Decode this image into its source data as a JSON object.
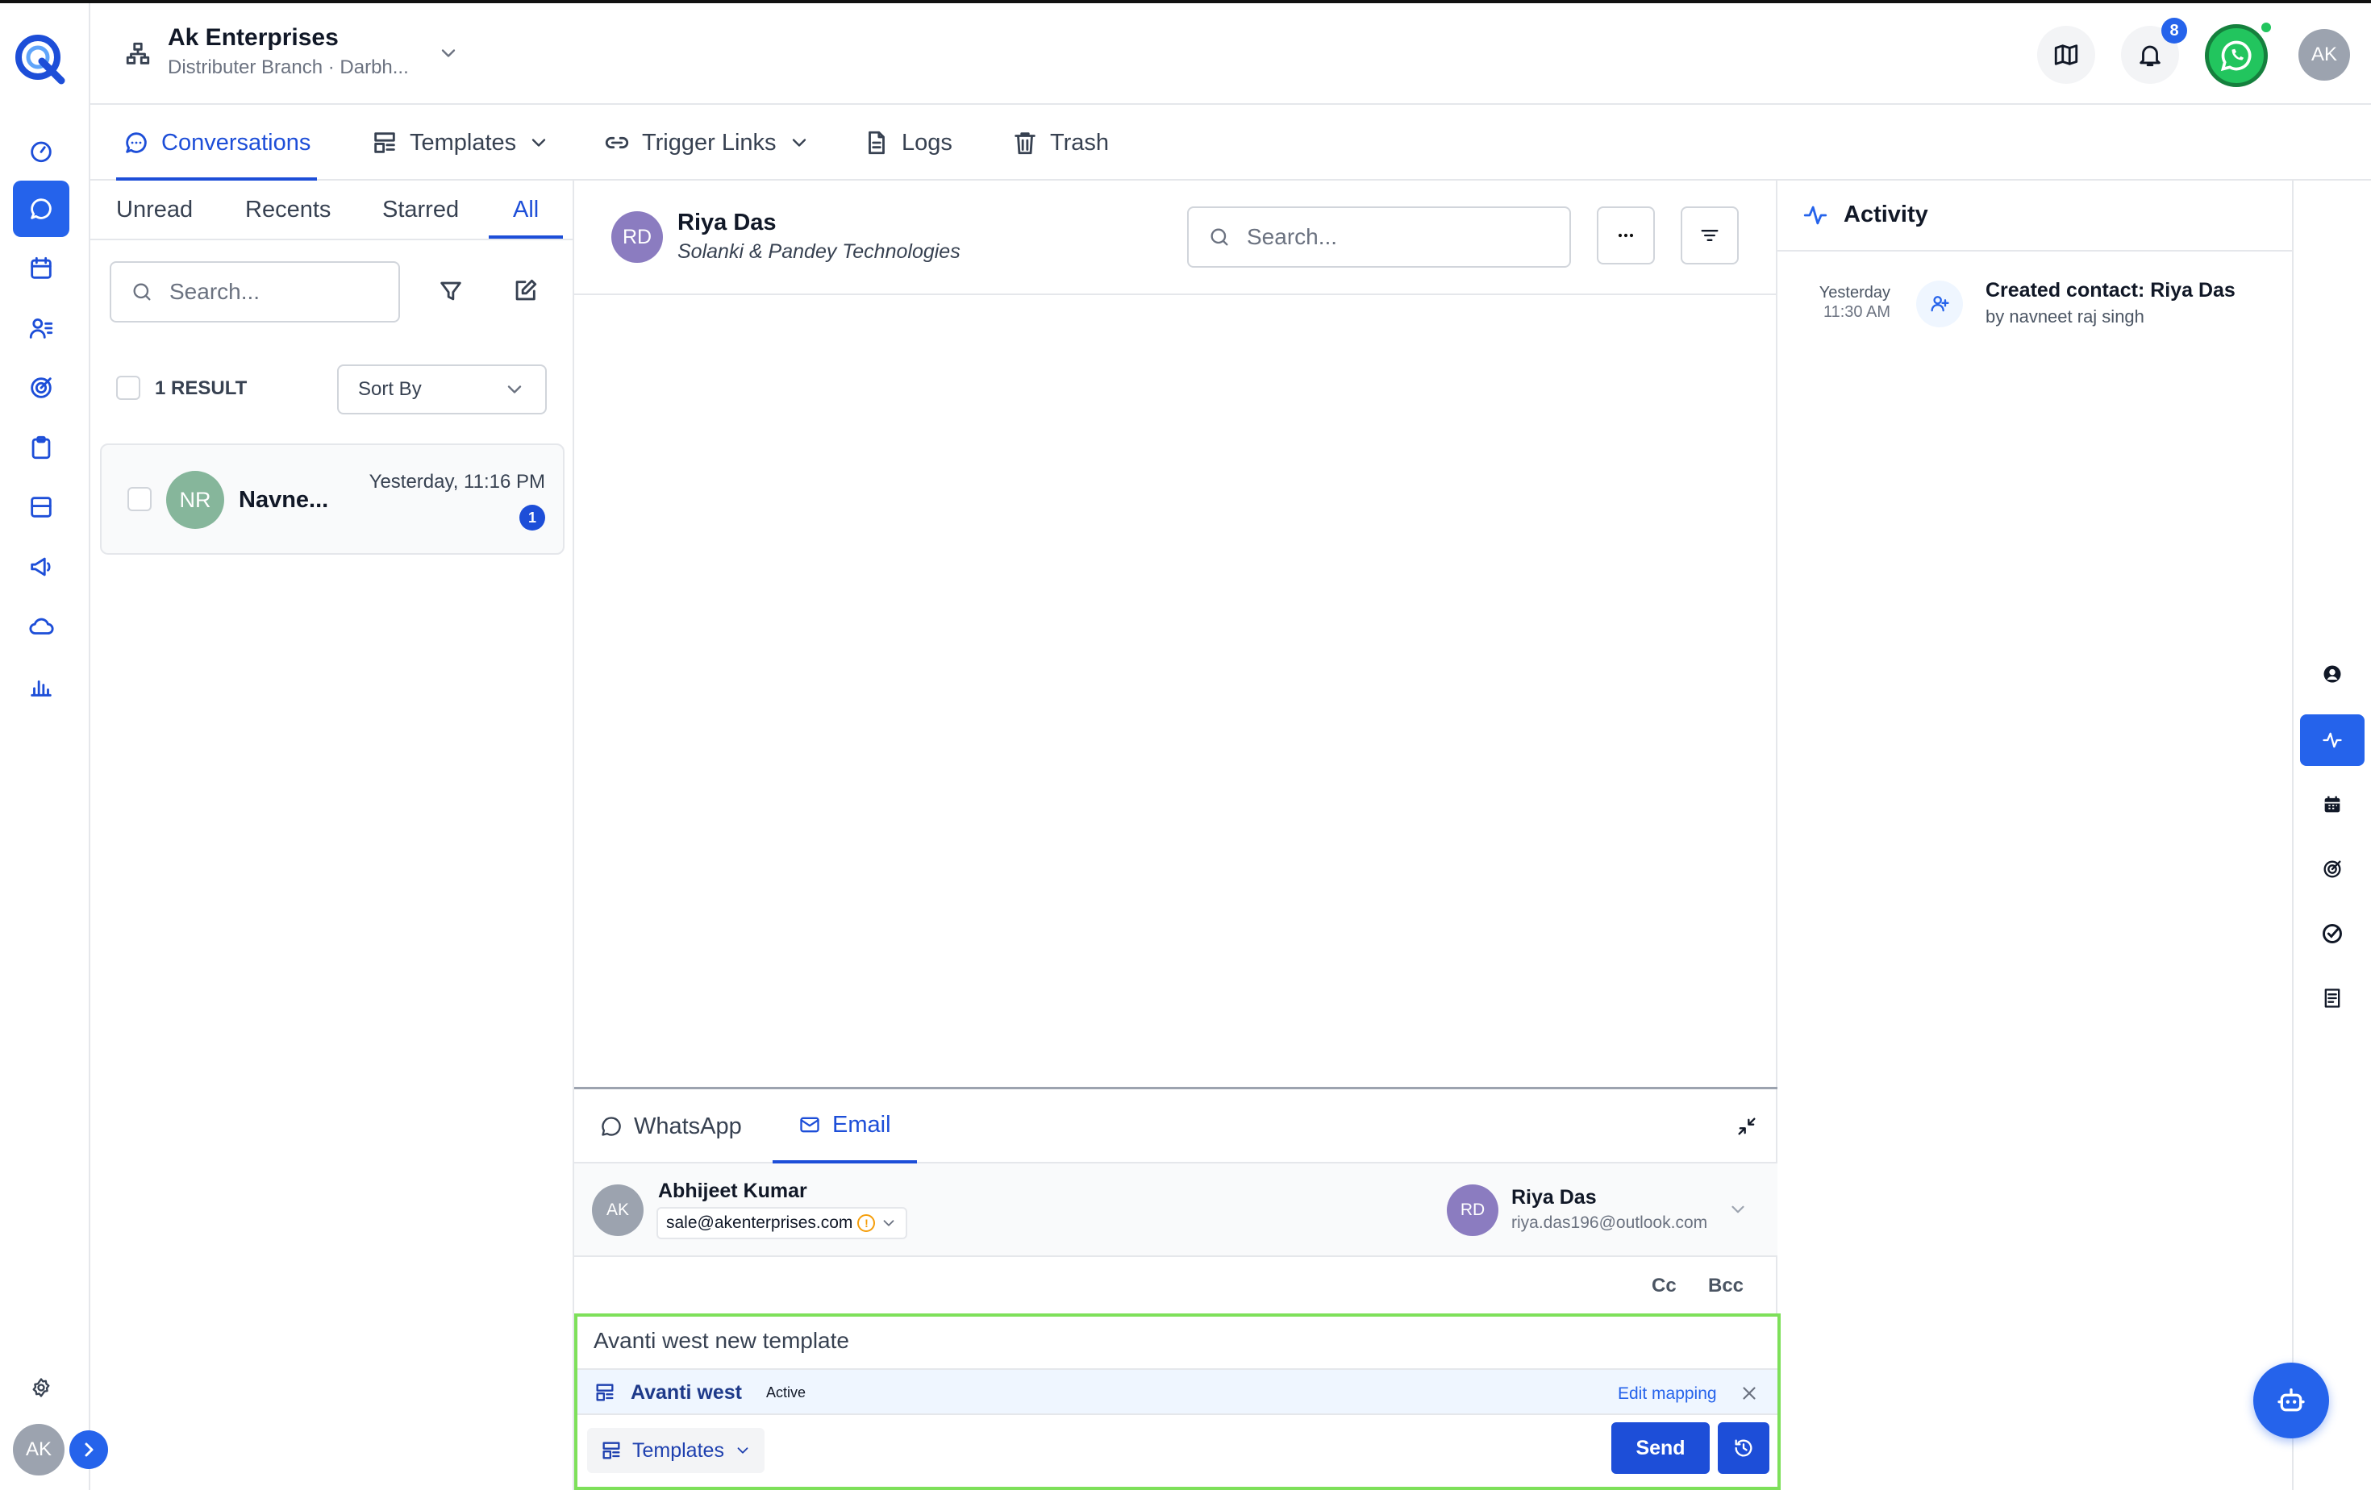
{
  "org": {
    "name": "Ak Enterprises",
    "branch": "Distributer Branch · Darbh..."
  },
  "header": {
    "notification_count": "8",
    "user_initials": "AK"
  },
  "nav_tabs": [
    {
      "label": "Conversations"
    },
    {
      "label": "Templates"
    },
    {
      "label": "Trigger Links"
    },
    {
      "label": "Logs"
    },
    {
      "label": "Trash"
    }
  ],
  "list": {
    "subtabs": [
      "Unread",
      "Recents",
      "Starred",
      "All"
    ],
    "search_placeholder": "Search...",
    "result_count": "1 RESULT",
    "sort_label": "Sort By",
    "items": [
      {
        "initials": "NR",
        "name": "Navne...",
        "time": "Yesterday, 11:16 PM",
        "unread": "1"
      }
    ]
  },
  "chat": {
    "contact_initials": "RD",
    "contact_name": "Riya Das",
    "contact_company": "Solanki & Pandey Technologies",
    "search_placeholder": "Search...",
    "channels": [
      "WhatsApp",
      "Email"
    ],
    "sender": {
      "initials": "AK",
      "name": "Abhijeet Kumar",
      "email": "sale@akenterprises.com"
    },
    "recipient": {
      "initials": "RD",
      "name": "Riya Das",
      "email": "riya.das196@outlook.com"
    },
    "cc_label": "Cc",
    "bcc_label": "Bcc",
    "subject": "Avanti west new template",
    "template": {
      "name": "Avanti west",
      "status": "Active",
      "edit_label": "Edit mapping"
    },
    "templates_button": "Templates",
    "send_label": "Send"
  },
  "activity": {
    "title": "Activity",
    "items": [
      {
        "date": "Yesterday",
        "time": "11:30 AM",
        "title": "Created contact: Riya Das",
        "by": "by navneet raj singh"
      }
    ]
  },
  "rail_user_initials": "AK",
  "colors": {
    "accent": "#2563eb",
    "whatsapp": "#22c55e",
    "highlight": "#7ee05a"
  }
}
